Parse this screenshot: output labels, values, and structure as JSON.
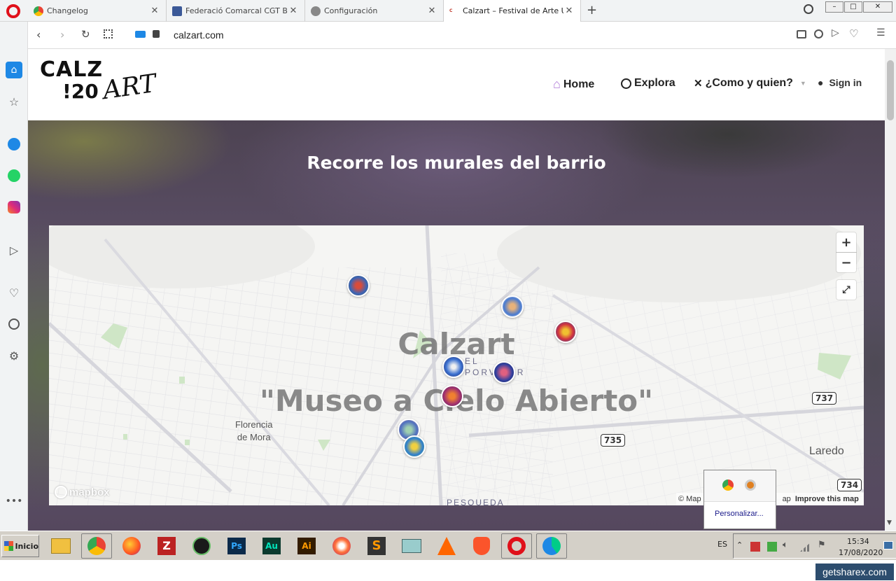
{
  "tabs": [
    {
      "title": "Changelog",
      "favicon_color": "#4c8bf5"
    },
    {
      "title": "Federació Comarcal CGT Baix",
      "favicon_color": "#3b5998"
    },
    {
      "title": "Configuración",
      "favicon_color": "#888888"
    },
    {
      "title": "Calzart – Festival de Arte Urb",
      "favicon_color": "#c0392b",
      "favicon_text": "CALZ"
    }
  ],
  "address": {
    "url": "calzart.com"
  },
  "site": {
    "logo": {
      "line1": "CALZ",
      "line2": "!20",
      "script": "ART"
    },
    "nav": [
      {
        "label": "Home",
        "icon": "home-icon",
        "color": "#b07bd8"
      },
      {
        "label": "Explora",
        "icon": "compass-icon"
      },
      {
        "label": "¿Como y quien?",
        "icon": "tools-icon",
        "has_dropdown": true
      },
      {
        "label": "Sign in",
        "icon": "user-icon"
      }
    ],
    "hero_title": "Recorre los murales del barrio"
  },
  "map": {
    "overlay_title": "Calzart",
    "overlay_subtitle": "\"Museo a Cielo Abierto\"",
    "places": [
      "Florencia\nde Mora",
      "Laredo",
      "EL\nPORVENIR",
      "PESQUEDA"
    ],
    "shields": [
      "737",
      "735",
      "734"
    ],
    "controls": {
      "zoom_in": "+",
      "zoom_out": "−"
    },
    "attribution": "© Map",
    "attribution_tail": "ap",
    "improve": "Improve this map",
    "logo": "mapbox"
  },
  "popup": {
    "label": "Personalizar..."
  },
  "taskbar": {
    "start": "Inicio",
    "lang": "ES",
    "time": "15:34",
    "date": "17/08/2020"
  },
  "watermark": "getsharex.com"
}
